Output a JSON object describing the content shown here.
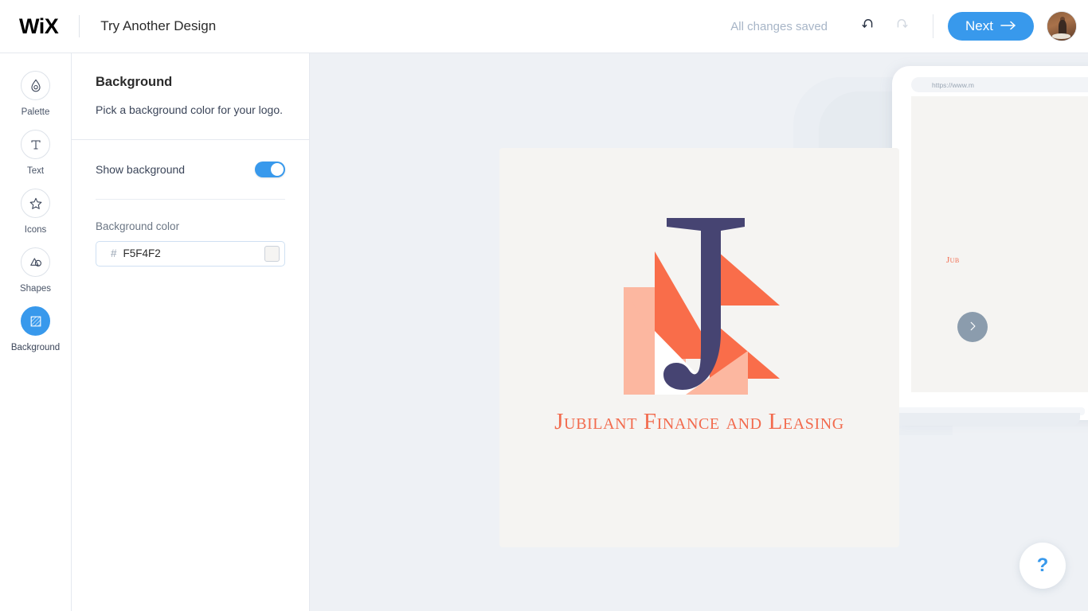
{
  "header": {
    "brand": "WiX",
    "title": "Try Another Design",
    "saved_status": "All changes saved",
    "undo_icon": "undo-icon",
    "redo_icon": "redo-icon",
    "next_label": "Next",
    "next_arrow": "arrow-right-icon",
    "avatar": "user-avatar",
    "accent_color": "#3899ec"
  },
  "sidebar": {
    "items": [
      {
        "label": "Palette",
        "icon": "droplet-icon",
        "active": false
      },
      {
        "label": "Text",
        "icon": "text-t-icon",
        "active": false
      },
      {
        "label": "Icons",
        "icon": "star-icon",
        "active": false
      },
      {
        "label": "Shapes",
        "icon": "shapes-icon",
        "active": false
      },
      {
        "label": "Background",
        "icon": "background-hatch-icon",
        "active": true
      }
    ]
  },
  "panel": {
    "title": "Background",
    "subtitle": "Pick a background color for your logo.",
    "show_background_label": "Show background",
    "show_background_on": true,
    "background_color_label": "Background color",
    "hash_symbol": "#",
    "hex_value": "F5F4F2",
    "hex_placeholder": "F5F4F2",
    "swatch_color": "#F5F4F2"
  },
  "canvas": {
    "background_color": "#eef1f5",
    "logo": {
      "card_color": "#F5F4F2",
      "letter": "J",
      "letter_color": "#464472",
      "text": "Jubilant Finance and Leasing",
      "text_color": "#F26B4E",
      "shape_colors": {
        "orange": "#F96D4A",
        "salmon": "#FCB7A0",
        "white": "#FFFFFF"
      }
    },
    "device_preview": {
      "url": "https://www.m",
      "logo_text": "Jub",
      "screen_color": "#F5F4F2"
    },
    "next_design_arrow": "chevron-right-icon",
    "help_label": "?"
  }
}
